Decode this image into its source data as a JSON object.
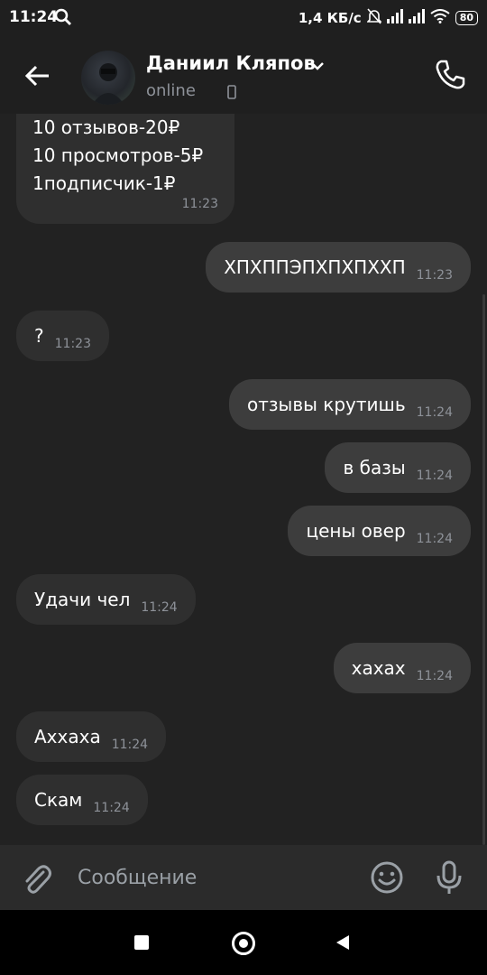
{
  "status_bar": {
    "time": "11:24",
    "speed": "1,4 КБ/с",
    "battery": "80"
  },
  "header": {
    "contact_name": "Даниил Кляпов",
    "status": "online"
  },
  "messages": [
    {
      "dir": "in",
      "lines": [
        "10 отзывов-20₽",
        "10 просмотров-5₽",
        "1подписчик-1₽"
      ],
      "time": "11:23"
    },
    {
      "dir": "out",
      "text": "ХПХППЭПХПХПХХП",
      "time": "11:23"
    },
    {
      "dir": "in",
      "text": "?",
      "time": "11:23"
    },
    {
      "dir": "out",
      "text": "отзывы крутишь",
      "time": "11:24"
    },
    {
      "dir": "out",
      "text": "в базы",
      "time": "11:24"
    },
    {
      "dir": "out",
      "text": "цены овер",
      "time": "11:24"
    },
    {
      "dir": "in",
      "text": "Удачи чел",
      "time": "11:24"
    },
    {
      "dir": "out",
      "text": "хахах",
      "time": "11:24"
    },
    {
      "dir": "in",
      "text": "Аххаха",
      "time": "11:24"
    },
    {
      "dir": "in",
      "text": "Скам",
      "time": "11:24"
    }
  ],
  "composer": {
    "placeholder": "Сообщение"
  },
  "colors": {
    "chat_bg": "#222222",
    "incoming_bubble": "#2f2f2f",
    "outgoing_bubble": "#3d3d3d",
    "header_bg": "#1f1f1f"
  },
  "icons": [
    "back-arrow-icon",
    "chevron-down-icon",
    "phone-icon",
    "call-icon",
    "paperclip-icon",
    "smile-icon",
    "microphone-icon"
  ]
}
